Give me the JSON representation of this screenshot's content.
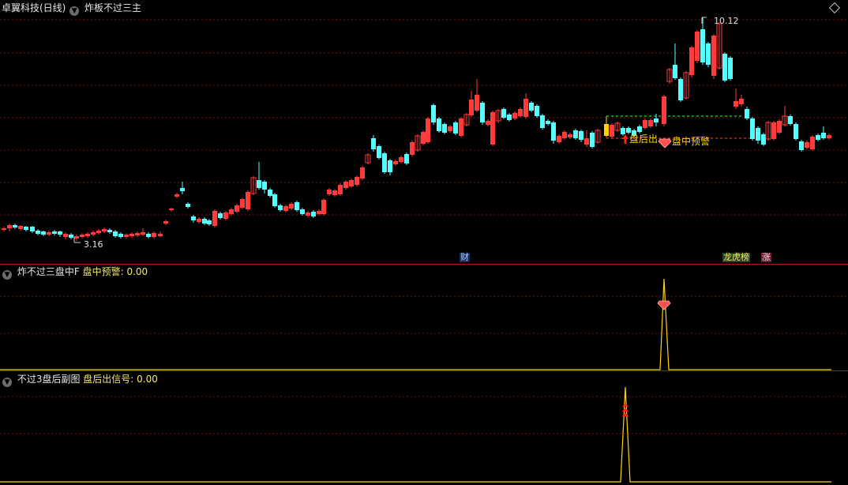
{
  "main_header": {
    "stock_name": "卓翼科技(日线)",
    "indicator_name": "炸板不过三主"
  },
  "main_chart": {
    "high_label": "10.12",
    "low_label": "3.16",
    "signal_after_close": "盘后出",
    "signal_intraday": "盘中预警",
    "tag_finance": "财",
    "tag_dragon_tiger": "龙虎榜",
    "tag_limit_up": "涨"
  },
  "sub1_header": {
    "indicator_name": "炸不过三盘中F",
    "series_label": "盘中预警:",
    "series_value": "0.00"
  },
  "sub2_header": {
    "indicator_name": "不过3盘后副图",
    "series_label": "盘后出信号:",
    "series_value": "0.00"
  },
  "colors": {
    "up": "#ff3b3b",
    "down": "#54ffff",
    "signal": "#ffd400",
    "grid": "#7a1010",
    "separator": "#a01818",
    "text_yellow": "#f2e96b"
  },
  "icons": [
    "collapse-arrow-icon",
    "settings-diamond-icon",
    "red-up-arrow-icon",
    "warning-gem-icon"
  ]
}
